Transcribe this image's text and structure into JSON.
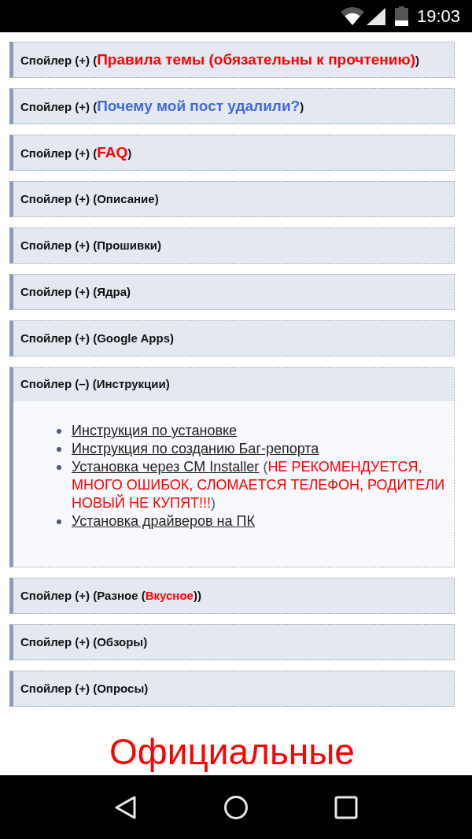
{
  "status_bar": {
    "time": "19:03"
  },
  "spoilers": [
    {
      "expanded": false,
      "title": [
        {
          "kind": "plain",
          "text": "Спойлер (+) ("
        },
        {
          "kind": "big_red",
          "text": "Правила темы (обязательны к прочтению)"
        },
        {
          "kind": "plain",
          "text": ")"
        }
      ]
    },
    {
      "expanded": false,
      "title": [
        {
          "kind": "plain",
          "text": "Спойлер (+) ("
        },
        {
          "kind": "big_blue",
          "text": "Почему мой пост удалили?"
        },
        {
          "kind": "plain",
          "text": ")"
        }
      ]
    },
    {
      "expanded": false,
      "title": [
        {
          "kind": "plain",
          "text": "Спойлер (+) ("
        },
        {
          "kind": "big_red",
          "text": "FAQ"
        },
        {
          "kind": "plain",
          "text": ")"
        }
      ]
    },
    {
      "expanded": false,
      "title": [
        {
          "kind": "plain",
          "text": "Спойлер (+) (Описание)"
        }
      ]
    },
    {
      "expanded": false,
      "title": [
        {
          "kind": "plain",
          "text": "Спойлер (+) (Прошивки)"
        }
      ]
    },
    {
      "expanded": false,
      "title": [
        {
          "kind": "plain",
          "text": "Спойлер (+) (Ядра)"
        }
      ]
    },
    {
      "expanded": false,
      "title": [
        {
          "kind": "plain",
          "text": "Спойлер (+) (Google Apps)"
        }
      ]
    },
    {
      "expanded": true,
      "title": [
        {
          "kind": "plain",
          "text": "Спойлер (–) (Инструкции)"
        }
      ],
      "items": [
        {
          "parts": [
            {
              "kind": "link",
              "text": "Инструкция по установке"
            }
          ]
        },
        {
          "parts": [
            {
              "kind": "link",
              "text": "Инструкция по созданию Баг-репорта"
            }
          ]
        },
        {
          "parts": [
            {
              "kind": "link",
              "text": "Установка через CM Installer"
            },
            {
              "kind": "plain",
              "text": " ("
            },
            {
              "kind": "red",
              "text": "НЕ РЕКОМЕНДУЕТСЯ, МНОГО ОШИБОК, СЛОМАЕТСЯ ТЕЛЕФОН, РОДИТЕЛИ НОВЫЙ НЕ КУПЯТ!!!"
            },
            {
              "kind": "plain",
              "text": ")"
            }
          ]
        },
        {
          "parts": [
            {
              "kind": "link",
              "text": "Установка драйверов на ПК"
            }
          ]
        }
      ]
    },
    {
      "expanded": false,
      "title": [
        {
          "kind": "plain",
          "text": "Спойлер (+) (Разное ("
        },
        {
          "kind": "red",
          "text": "Вкусное"
        },
        {
          "kind": "plain",
          "text": "))"
        }
      ]
    },
    {
      "expanded": false,
      "title": [
        {
          "kind": "plain",
          "text": "Спойлер (+) (Обзоры)"
        }
      ]
    },
    {
      "expanded": false,
      "title": [
        {
          "kind": "plain",
          "text": "Спойлер (+) (Опросы)"
        }
      ]
    }
  ],
  "heading": "Официальные"
}
